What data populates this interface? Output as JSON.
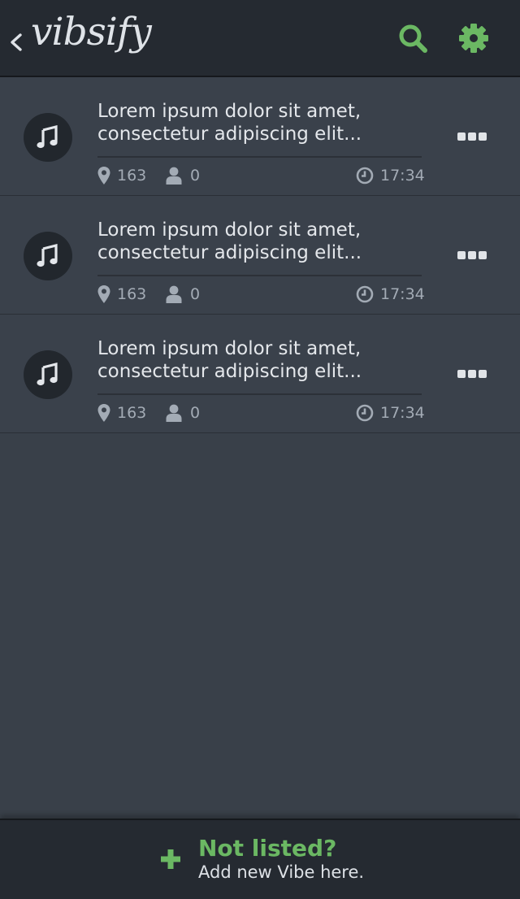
{
  "header": {
    "logo": "vibsify",
    "back_icon": "chevron-left-icon",
    "search_icon": "search-icon",
    "settings_icon": "gear-icon"
  },
  "colors": {
    "accent": "#6bb863",
    "header_bg": "#252a31",
    "body_bg": "#394049"
  },
  "items": [
    {
      "title_line1": "Lorem ipsum dolor sit amet,",
      "title_line2": "consectetur adipiscing elit...",
      "location_count": "163",
      "user_count": "0",
      "time": "17:34",
      "icon": "music-note-icon"
    },
    {
      "title_line1": "Lorem ipsum dolor sit amet,",
      "title_line2": "consectetur adipiscing elit...",
      "location_count": "163",
      "user_count": "0",
      "time": "17:34",
      "icon": "music-note-icon"
    },
    {
      "title_line1": "Lorem ipsum dolor sit amet,",
      "title_line2": "consectetur adipiscing elit...",
      "location_count": "163",
      "user_count": "0",
      "time": "17:34",
      "icon": "music-note-icon"
    }
  ],
  "footer": {
    "title": "Not listed?",
    "subtitle": "Add new Vibe here.",
    "icon": "plus-icon"
  }
}
